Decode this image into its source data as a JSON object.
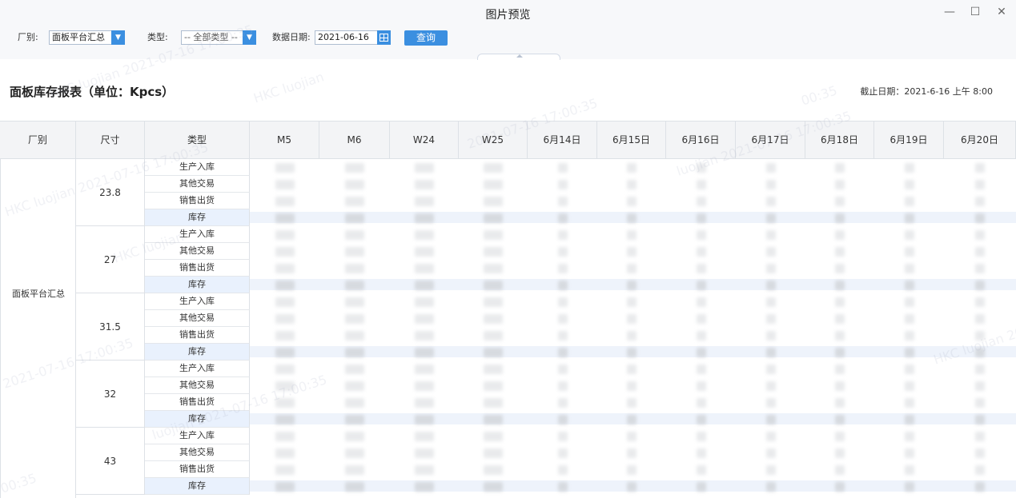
{
  "window": {
    "title": "图片预览",
    "controls": [
      "—",
      "☐",
      "✕"
    ]
  },
  "toolbar": {
    "factory_label": "厂别:",
    "factory_value": "面板平台汇总",
    "type_label": "类型:",
    "type_value": "-- 全部类型 --",
    "date_label": "数据日期:",
    "date_value": "2021-06-16",
    "query_label": "查询"
  },
  "report": {
    "title": "面板库存报表（单位：Kpcs）",
    "deadline": "截止日期：2021-6-16 上午 8:00"
  },
  "table": {
    "headers": [
      "厂别",
      "尺寸",
      "类型",
      "M5",
      "M6",
      "W24",
      "W25",
      "6月14日",
      "6月15日",
      "6月16日",
      "6月17日",
      "6月18日",
      "6月19日",
      "6月20日"
    ],
    "factory": "面板平台汇总",
    "sizes": [
      {
        "size": "23.8",
        "types": [
          "生产入库",
          "其他交易",
          "销售出货",
          "库存"
        ]
      },
      {
        "size": "27",
        "types": [
          "生产入库",
          "其他交易",
          "销售出货",
          "库存"
        ]
      },
      {
        "size": "31.5",
        "types": [
          "生产入库",
          "其他交易",
          "销售出货",
          "库存"
        ]
      },
      {
        "size": "32",
        "types": [
          "生产入库",
          "其他交易",
          "销售出货",
          "库存"
        ]
      },
      {
        "size": "43",
        "types": [
          "生产入库",
          "其他交易",
          "销售出货",
          "库存"
        ]
      }
    ]
  },
  "watermark": {
    "texts": [
      "HKC luojian 2021-07-16 17:00:35",
      "HKC luojian",
      "2021-07-16 17:00:35",
      "luojian 2021-07-16 17:00:35",
      "00:35"
    ]
  },
  "colors": {
    "accent": "#3b8fe0",
    "header_bg": "#f3f4f6",
    "stock_row_bg": "#e9f1fd"
  }
}
